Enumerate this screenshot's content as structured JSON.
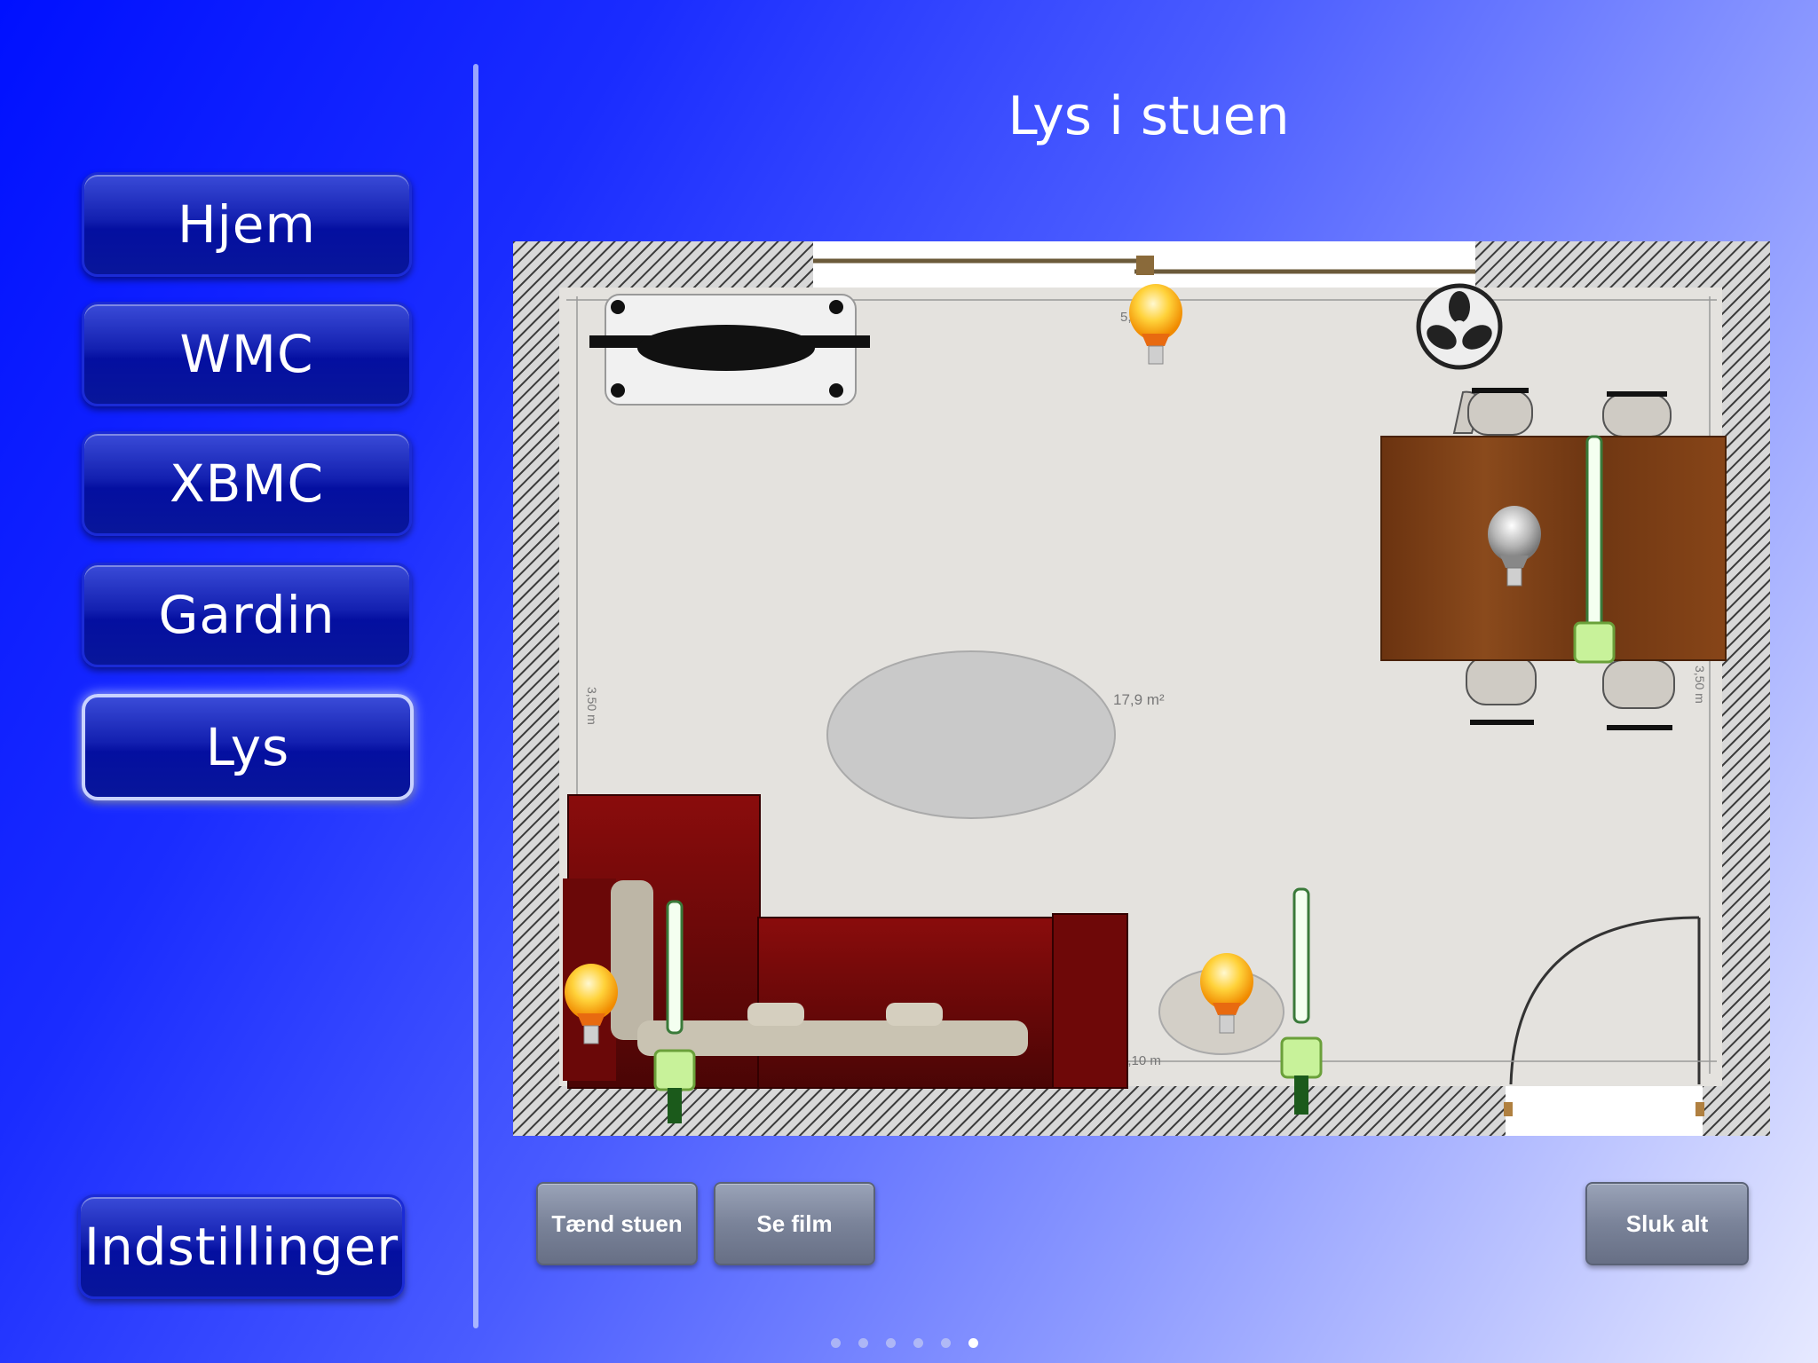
{
  "nav": {
    "items": [
      {
        "label": "Hjem"
      },
      {
        "label": "WMC"
      },
      {
        "label": "XBMC"
      },
      {
        "label": "Gardin"
      },
      {
        "label": "Lys"
      }
    ],
    "active": "Lys",
    "settings_label": "Indstillinger"
  },
  "page": {
    "title": "Lys i stuen"
  },
  "floorplan": {
    "area": "17,9 m²",
    "dim_left": "3,50 m",
    "dim_right": "3,50 m",
    "dim_bottom": "5,10 m",
    "dim_top": "5,"
  },
  "actions": {
    "turn_on_label": "Tænd stuen",
    "movie_label": "Se film",
    "all_off_label": "Sluk alt"
  },
  "pager": {
    "count": 6,
    "current": 6
  }
}
